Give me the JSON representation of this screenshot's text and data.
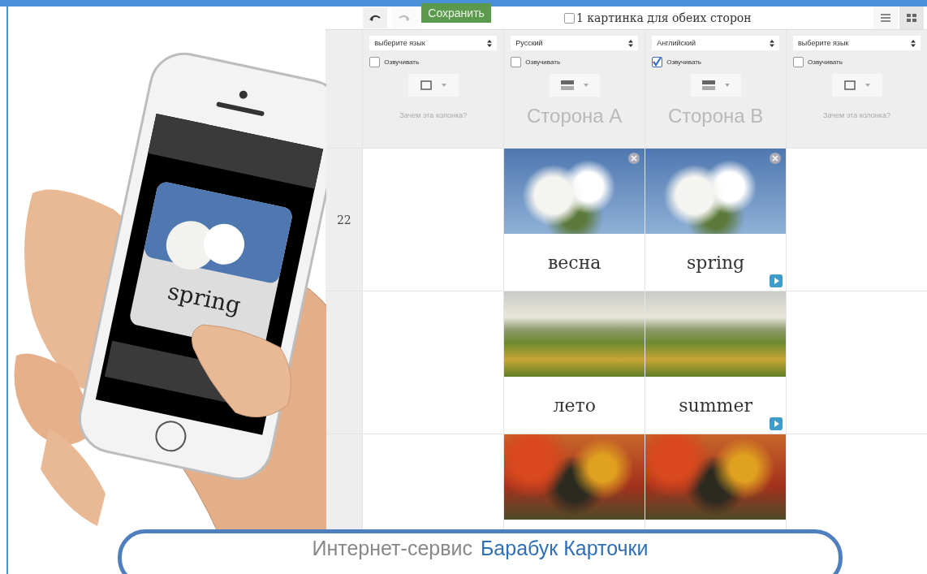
{
  "phone": {
    "card_word": "spring"
  },
  "toolbar": {
    "save_button": "Сохранить",
    "same_image_option": {
      "label": "1 картинка для обеих сторон",
      "checked": false
    },
    "view_modes": [
      {
        "kind": "list",
        "selected": false
      },
      {
        "kind": "grid",
        "selected": true
      }
    ]
  },
  "columns": [
    {
      "language": "выберите язык",
      "voice": {
        "label": "Озвучивать",
        "checked": false
      },
      "layout": {
        "kind": "single"
      },
      "caption": {
        "kind": "hint",
        "text": "Зачем эта колонка?"
      }
    },
    {
      "language": "Русский",
      "voice": {
        "label": "Озвучивать",
        "checked": false
      },
      "layout": {
        "kind": "split"
      },
      "caption": {
        "kind": "side",
        "text": "Сторона А"
      }
    },
    {
      "language": "Английский",
      "voice": {
        "label": "Озвучивать",
        "checked": true
      },
      "layout": {
        "kind": "split"
      },
      "caption": {
        "kind": "side",
        "text": "Сторона В"
      }
    },
    {
      "language": "выберите язык",
      "voice": {
        "label": "Озвучивать",
        "checked": false
      },
      "layout": {
        "kind": "single"
      },
      "caption": {
        "kind": "hint",
        "text": "Зачем эта колонка?"
      }
    }
  ],
  "rows": [
    {
      "number": "22",
      "cells": [
        {
          "kind": "empty"
        },
        {
          "kind": "card",
          "word": "весна",
          "removable": true,
          "audio": false
        },
        {
          "kind": "card",
          "word": "spring",
          "removable": true,
          "audio": true
        },
        {
          "kind": "empty"
        }
      ]
    },
    {
      "cells": [
        {
          "kind": "empty"
        },
        {
          "kind": "card",
          "word": "лето",
          "removable": false,
          "audio": false
        },
        {
          "kind": "card",
          "word": "summer",
          "removable": false,
          "audio": true
        },
        {
          "kind": "empty"
        }
      ]
    },
    {
      "cells": [
        {
          "kind": "empty"
        },
        {
          "kind": "card",
          "removable": false,
          "audio": false
        },
        {
          "kind": "card",
          "removable": false,
          "audio": false
        },
        {
          "kind": "empty"
        }
      ]
    }
  ],
  "banner": {
    "prefix": "Интернет-сервис",
    "link": "Барабук Карточки"
  }
}
